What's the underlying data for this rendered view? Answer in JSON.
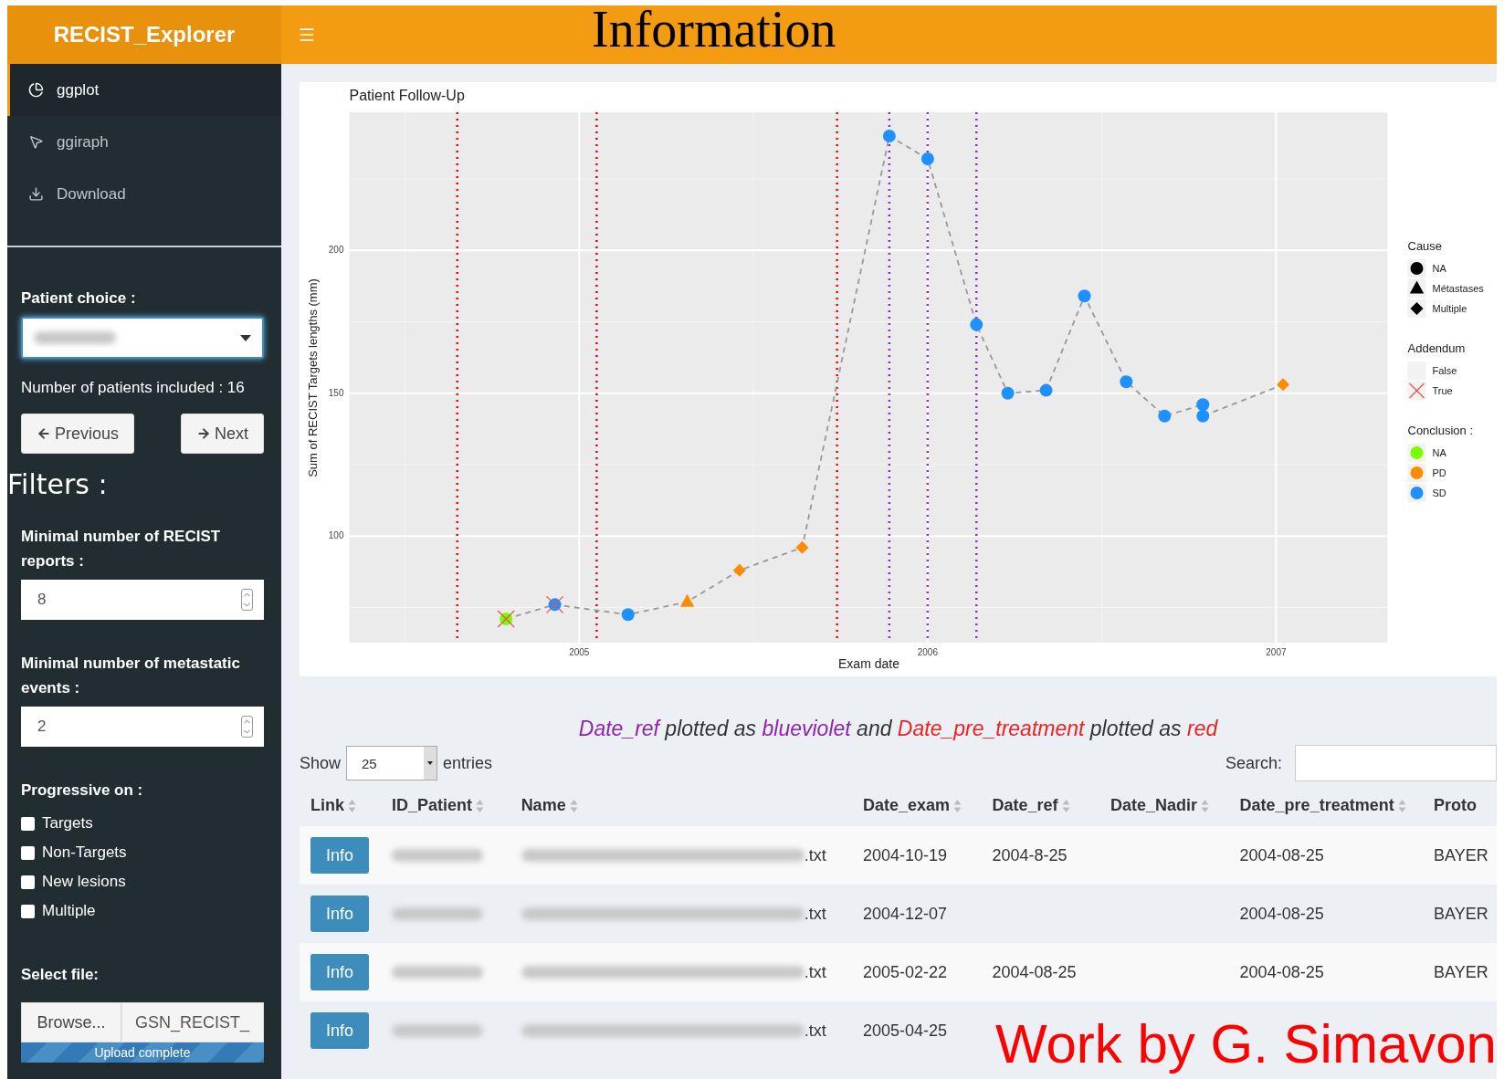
{
  "slide_title": "Information",
  "header": {
    "brand": "RECIST_Explorer"
  },
  "sidebar": {
    "menu": [
      {
        "label": "ggplot",
        "selected": true
      },
      {
        "label": "ggiraph",
        "selected": false
      },
      {
        "label": "Download",
        "selected": false
      }
    ],
    "patient_choice": {
      "label": "Patient choice :"
    },
    "patients_count": "Number of patients included : 16",
    "nav_buttons": [
      {
        "label": "Previous"
      },
      {
        "label": "Next"
      }
    ],
    "filters_title": "Filters :",
    "min_reports": {
      "label": "Minimal number of RECIST reports :",
      "value": "8"
    },
    "min_metastatic": {
      "label": "Minimal number of metastatic events :",
      "value": "2"
    },
    "progressive": {
      "label": "Progressive on :",
      "options": [
        {
          "label": "Targets",
          "checked": false
        },
        {
          "label": "Non-Targets",
          "checked": false
        },
        {
          "label": "New lesions",
          "checked": false
        },
        {
          "label": "Multiple",
          "checked": false
        }
      ]
    },
    "file": {
      "label": "Select file:",
      "button": "Browse...",
      "filename": "GSN_RECIST_",
      "progress": {
        "text": "Upload complete",
        "level": 1
      }
    }
  },
  "main": {
    "chart": {
      "chart_data": {
        "type": "line",
        "title": "Patient Follow-Up",
        "xlabel": "Exam date",
        "ylabel": "Sum of RECIST Targets lengths (mm)",
        "x": [
          2004.79,
          2004.93,
          2005.14,
          2005.31,
          2005.46,
          2005.64,
          2005.89,
          2006.0,
          2006.14,
          2006.23,
          2006.34,
          2006.45,
          2006.57,
          2006.68,
          2006.79,
          2006.79,
          2007.02
        ],
        "series": [
          {
            "color": "#999999",
            "line_style": "dashed",
            "marker": true,
            "values": [
              71,
              76,
              72.5,
              77,
              88,
              96,
              240,
              232,
              174,
              150,
              151,
              184,
              154,
              142,
              146,
              142,
              153
            ]
          }
        ],
        "xlim": [
          2004.34,
          2007.32
        ],
        "ylim": [
          62.7,
          248.3
        ],
        "xticks": [
          2005,
          2006,
          2007
        ],
        "yticks": [
          100,
          150,
          200
        ],
        "grid": true,
        "ref_lines": [
          {
            "axis": "x",
            "value": 2004.65,
            "color": "#ff0000"
          },
          {
            "axis": "x",
            "value": 2005.05,
            "color": "#ff0000"
          },
          {
            "axis": "x",
            "value": 2005.74,
            "color": "#ff0000"
          },
          {
            "axis": "x",
            "value": 2005.89,
            "color": "#8a2be2"
          },
          {
            "axis": "x",
            "value": 2006.0,
            "color": "#8a2be2"
          },
          {
            "axis": "x",
            "value": 2006.14,
            "color": "#8a2be2"
          }
        ]
      },
      "points": [
        {
          "kind": "circle",
          "color": "#7cfc00",
          "addendum": true
        },
        {
          "kind": "circle",
          "color": "#1e90ff",
          "addendum": true
        },
        {
          "kind": "circle",
          "color": "#1e90ff",
          "addendum": false
        },
        {
          "kind": "triangle",
          "color": "#ff8c00",
          "addendum": false
        },
        {
          "kind": "diamond",
          "color": "#ff8c00",
          "addendum": false
        },
        {
          "kind": "diamond",
          "color": "#ff8c00",
          "addendum": false
        },
        {
          "kind": "circle",
          "color": "#1e90ff",
          "addendum": false
        },
        {
          "kind": "circle",
          "color": "#1e90ff",
          "addendum": false
        },
        {
          "kind": "circle",
          "color": "#1e90ff",
          "addendum": false
        },
        {
          "kind": "circle",
          "color": "#1e90ff",
          "addendum": false
        },
        {
          "kind": "circle",
          "color": "#1e90ff",
          "addendum": false
        },
        {
          "kind": "circle",
          "color": "#1e90ff",
          "addendum": false
        },
        {
          "kind": "circle",
          "color": "#1e90ff",
          "addendum": false
        },
        {
          "kind": "circle",
          "color": "#1e90ff",
          "addendum": false
        },
        {
          "kind": "circle",
          "color": "#1e90ff",
          "addendum": false
        },
        {
          "kind": "circle",
          "color": "#1e90ff",
          "addendum": false
        },
        {
          "kind": "diamond",
          "color": "#ff8c00",
          "addendum": false
        }
      ],
      "legend": [
        {
          "title": "Cause",
          "items": [
            {
              "label": "NA",
              "kind": "circle"
            },
            {
              "label": "Métastases",
              "kind": "triangle"
            },
            {
              "label": "Multiple",
              "kind": "diamond"
            }
          ]
        },
        {
          "title": "Addendum",
          "items": [
            {
              "label": "False",
              "kind": "none"
            },
            {
              "label": "True",
              "kind": "cross"
            }
          ]
        },
        {
          "title": "Conclusion :",
          "items": [
            {
              "label": "NA",
              "kind": "circle",
              "color": "#7cfc00"
            },
            {
              "label": "PD",
              "kind": "circle",
              "color": "#ff8c00"
            },
            {
              "label": "SD",
              "kind": "circle",
              "color": "#1e90ff"
            }
          ]
        }
      ]
    },
    "caption": [
      {
        "text": "Date_ref",
        "color": "#8e24aa"
      },
      {
        "text": " plotted as ",
        "color": "#333333"
      },
      {
        "text": "blueviolet",
        "color": "#8e24aa"
      },
      {
        "text": " and ",
        "color": "#333333"
      },
      {
        "text": "Date_pre_treatment",
        "color": "#ee2222"
      },
      {
        "text": " plotted as ",
        "color": "#333333"
      },
      {
        "text": "red",
        "color": "#ee2222"
      }
    ],
    "table": {
      "show_label": "Show",
      "length_value": "25",
      "entries_label": "entries",
      "search_label": "Search:",
      "columns": [
        {
          "label": "Link"
        },
        {
          "label": "ID_Patient"
        },
        {
          "label": "Name"
        },
        {
          "label": "Date_exam"
        },
        {
          "label": "Date_ref"
        },
        {
          "label": "Date_Nadir"
        },
        {
          "label": "Date_pre_treatment"
        },
        {
          "label": "Proto"
        }
      ],
      "rows": [
        {
          "link": "Info",
          "name": ".txt",
          "date_exam": "2004-10-19",
          "date_ref": "2004-8-25",
          "date_pre": "2004-08-25",
          "protocol": "BAYER"
        },
        {
          "link": "Info",
          "name": ".txt",
          "date_exam": "2004-12-07",
          "date_pre": "2004-08-25",
          "protocol": "BAYER"
        },
        {
          "link": "Info",
          "name": ".txt",
          "date_exam": "2005-02-22",
          "date_ref": "2004-08-25",
          "date_pre": "2004-08-25",
          "protocol": "BAYER"
        },
        {
          "link": "Info",
          "name": ".txt",
          "date_exam": "2005-04-25"
        }
      ]
    }
  },
  "credit": "Work by G. Simavon"
}
